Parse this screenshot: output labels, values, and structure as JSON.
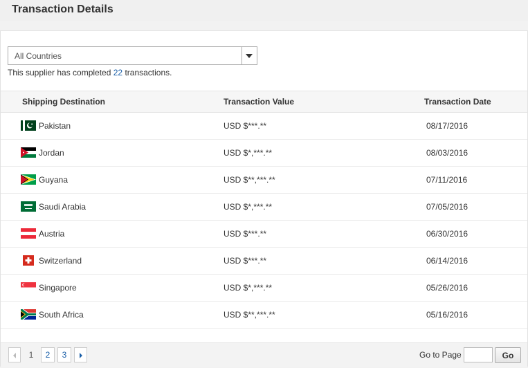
{
  "header": {
    "title": "Transaction Details"
  },
  "filter": {
    "selected": "All Countries"
  },
  "summary": {
    "prefix": "This supplier has completed ",
    "count": "22",
    "suffix": " transactions."
  },
  "table": {
    "columns": [
      "Shipping Destination",
      "Transaction Value",
      "Transaction Date"
    ],
    "rows": [
      {
        "country": "Pakistan",
        "flag": "flag-pakistan-icon",
        "value": "USD $***.**",
        "date": "08/17/2016"
      },
      {
        "country": "Jordan",
        "flag": "flag-jordan-icon",
        "value": "USD $*,***.**",
        "date": "08/03/2016"
      },
      {
        "country": "Guyana",
        "flag": "flag-guyana-icon",
        "value": "USD $**,***.**",
        "date": "07/11/2016"
      },
      {
        "country": "Saudi Arabia",
        "flag": "flag-saudi-arabia-icon",
        "value": "USD $*,***.**",
        "date": "07/05/2016"
      },
      {
        "country": "Austria",
        "flag": "flag-austria-icon",
        "value": "USD $***.**",
        "date": "06/30/2016"
      },
      {
        "country": "Switzerland",
        "flag": "flag-switzerland-icon",
        "value": "USD $***.**",
        "date": "06/14/2016"
      },
      {
        "country": "Singapore",
        "flag": "flag-singapore-icon",
        "value": "USD $*,***.**",
        "date": "05/26/2016"
      },
      {
        "country": "South Africa",
        "flag": "flag-south-africa-icon",
        "value": "USD $**,***.**",
        "date": "05/16/2016"
      }
    ]
  },
  "pagination": {
    "current": "1",
    "page2": "2",
    "page3": "3",
    "goto_label": "Go to Page",
    "goto_value": "",
    "go_label": "Go"
  },
  "colors": {
    "link": "#1a5fa8",
    "header_bg": "#f0f0f0",
    "table_head_bg": "#f6f6f6"
  }
}
